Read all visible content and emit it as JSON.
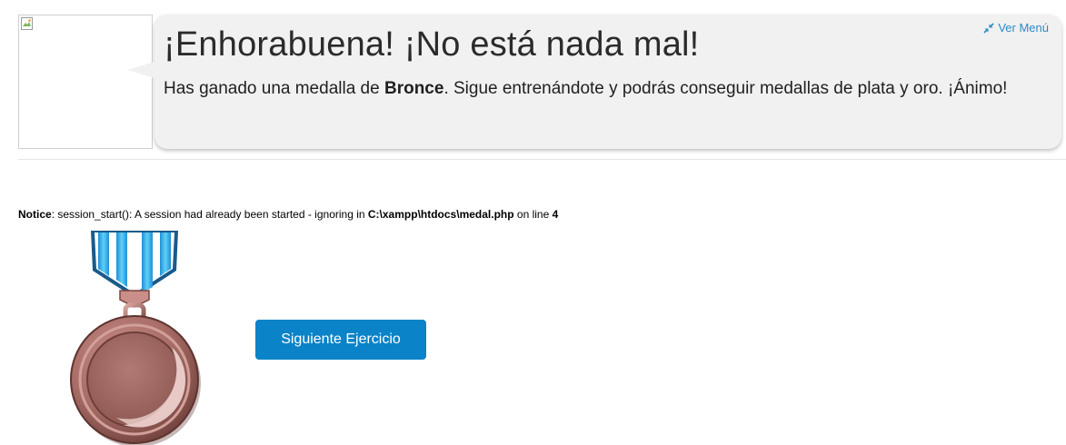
{
  "speech_bubble": {
    "headline": "¡Enhorabuena! ¡No está nada mal!",
    "message_prefix": "Has ganado una medalla de ",
    "medal_type": "Bronce",
    "message_suffix": ". Sigue entrenándote y podrás conseguir medallas de plata y oro. ¡Ánimo!",
    "menu_link_label": "Ver Menú"
  },
  "notice": {
    "label": "Notice",
    "text": ": session_start(): A session had already been started - ignoring in ",
    "file_path": "C:\\xampp\\htdocs\\medal.php",
    "line_text": " on line ",
    "line_number": "4"
  },
  "actions": {
    "next_button_label": "Siguiente Ejercicio"
  },
  "colors": {
    "accent": "#0a83c8",
    "link": "#2a8ac4",
    "bubble_bg": "#f1f1f1",
    "bronze": "#a86c66",
    "ribbon_blue": "#38b6ee"
  },
  "icons": {
    "avatar": "broken-image-icon",
    "menu": "compress-arrows-icon",
    "medal": "bronze-medal-icon"
  }
}
